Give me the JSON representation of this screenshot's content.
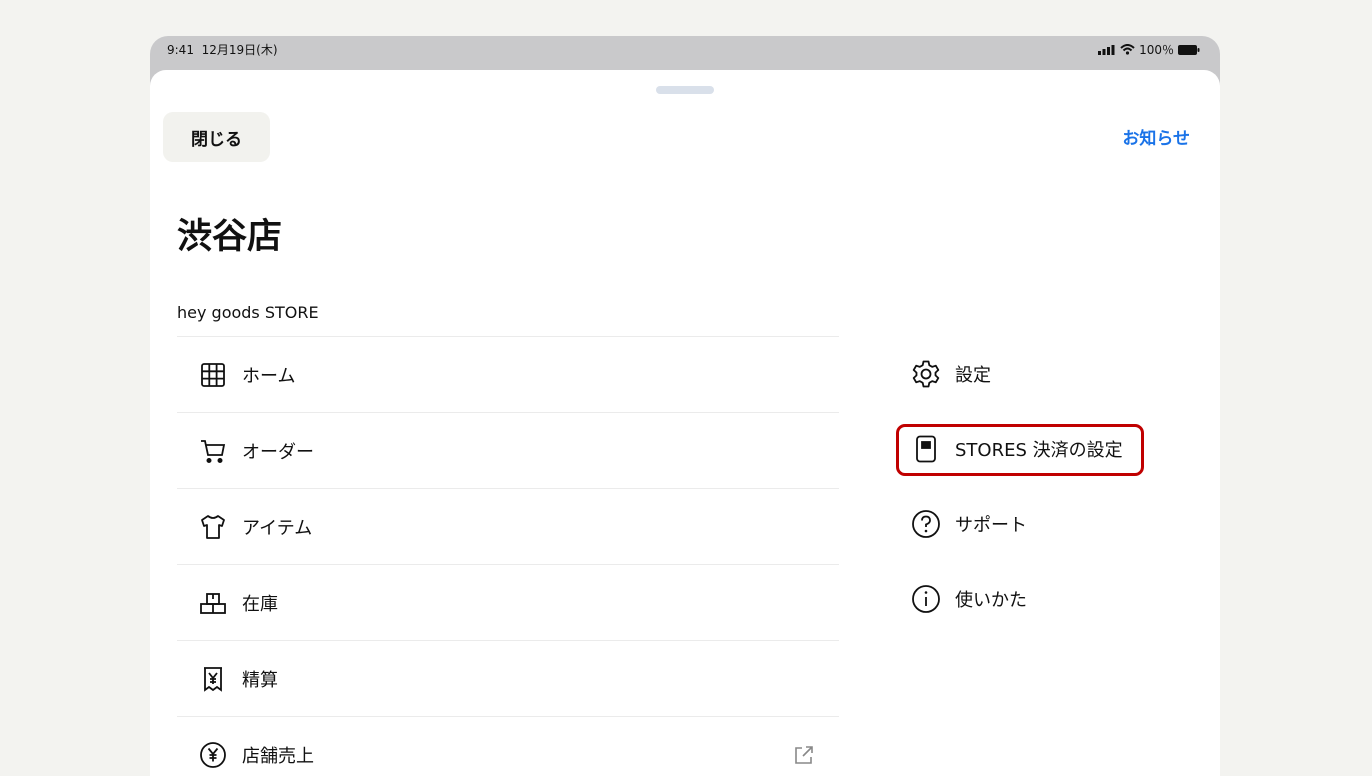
{
  "status": {
    "time": "9:41",
    "date": "12月19日(木)",
    "battery": "100％"
  },
  "header": {
    "close_label": "閉じる",
    "notice_label": "お知らせ"
  },
  "store": {
    "name": "渋谷店",
    "subtitle": "hey goods STORE"
  },
  "menu_left": [
    {
      "label": "ホーム",
      "icon": "grid-icon"
    },
    {
      "label": "オーダー",
      "icon": "cart-icon"
    },
    {
      "label": "アイテム",
      "icon": "shirt-icon"
    },
    {
      "label": "在庫",
      "icon": "boxes-icon"
    },
    {
      "label": "精算",
      "icon": "receipt-yen-icon"
    },
    {
      "label": "店舗売上",
      "icon": "yen-circle-icon",
      "external": true
    }
  ],
  "menu_right": [
    {
      "label": "設定",
      "icon": "gear-icon"
    },
    {
      "label": "STORES 決済の設定",
      "icon": "card-reader-icon",
      "highlighted": true
    },
    {
      "label": "サポート",
      "icon": "question-circle-icon"
    },
    {
      "label": "使いかた",
      "icon": "info-circle-icon"
    }
  ],
  "colors": {
    "accent": "#1a73e8",
    "highlight": "#c00000",
    "text": "#111111"
  }
}
